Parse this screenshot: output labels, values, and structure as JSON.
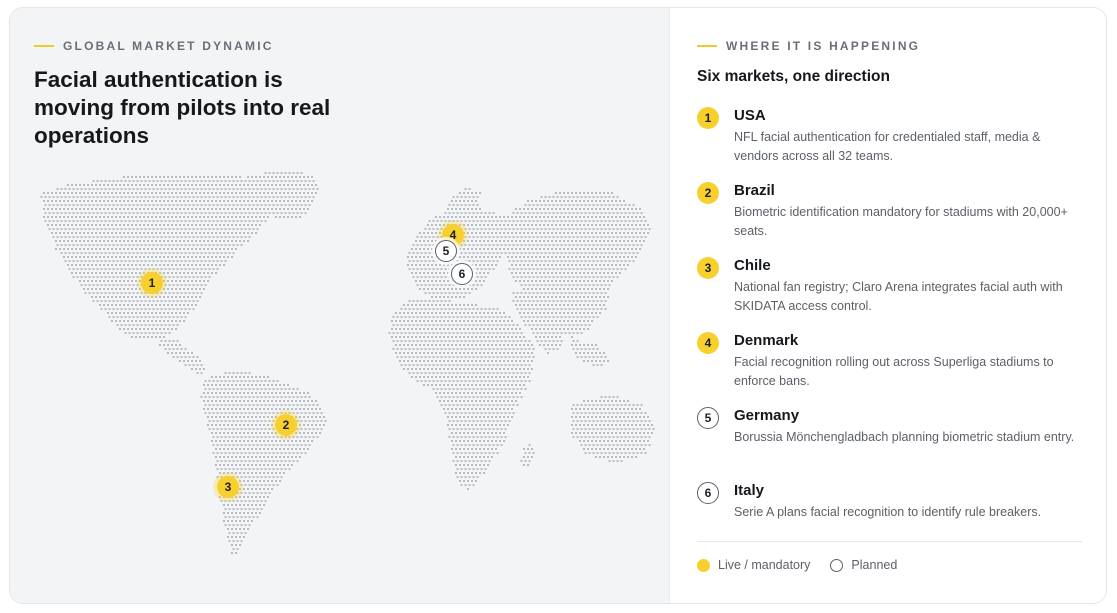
{
  "left": {
    "eyebrow": "GLOBAL MARKET DYNAMIC",
    "headline": "Facial authentication is moving from pilots into real operations"
  },
  "right": {
    "eyebrow": "WHERE IT IS HAPPENING",
    "subheading": "Six markets, one direction"
  },
  "markets": [
    {
      "number": "1",
      "name": "USA",
      "status": "live",
      "description": "NFL facial authentication for credentialed staff, media & vendors across all 32 teams."
    },
    {
      "number": "2",
      "name": "Brazil",
      "status": "live",
      "description": "Biometric identification mandatory for stadiums with 20,000+ seats."
    },
    {
      "number": "3",
      "name": "Chile",
      "status": "live",
      "description": "National fan registry; Claro Arena integrates facial auth with SKIDATA access control."
    },
    {
      "number": "4",
      "name": "Denmark",
      "status": "live",
      "description": "Facial recognition rolling out across Superliga stadiums to enforce bans."
    },
    {
      "number": "5",
      "name": "Germany",
      "status": "planned",
      "description": "Borussia Mönchengladbach planning biometric stadium entry."
    },
    {
      "number": "6",
      "name": "Italy",
      "status": "planned",
      "description": "Serie A plans facial recognition to identify rule breakers."
    }
  ],
  "legend": {
    "live_label": "Live / mandatory",
    "planned_label": "Planned"
  },
  "colors": {
    "accent_yellow": "#f7d02e",
    "planned_outline": "#5c6168",
    "map_dot": "#b7bcc3",
    "panel_bg": "#f3f4f6"
  }
}
